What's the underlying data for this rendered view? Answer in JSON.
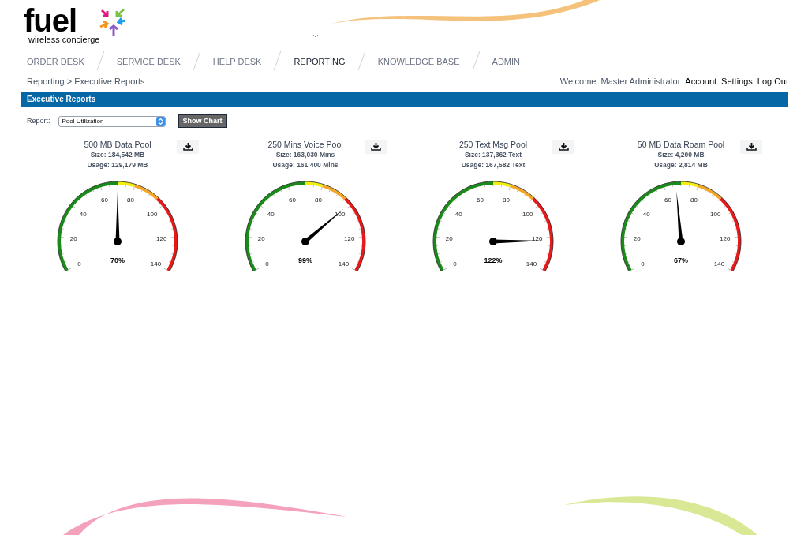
{
  "logo": {
    "wordmark": "fuel",
    "tagline": "wireless concierge"
  },
  "nav": [
    {
      "label": "ORDER DESK",
      "selected": false
    },
    {
      "label": "SERVICE DESK",
      "selected": false
    },
    {
      "label": "HELP DESK",
      "selected": false
    },
    {
      "label": "REPORTING",
      "selected": true
    },
    {
      "label": "KNOWLEDGE BASE",
      "selected": false
    },
    {
      "label": "ADMIN",
      "selected": false
    }
  ],
  "breadcrumb": "Reporting > Executive Reports",
  "user_bar": {
    "welcome": "Welcome",
    "user": "Master Administrator",
    "links": [
      "Account",
      "Settings",
      "Log Out"
    ]
  },
  "section_title": "Executive Reports",
  "report": {
    "label": "Report:",
    "value": "Pool Utilization",
    "button": "Show Chart"
  },
  "gauges": [
    {
      "title": "500 MB Data Pool",
      "size": "Size: 184,542 MB",
      "usage": "Usage: 129,179 MB",
      "reading": "70%",
      "level": 0.5,
      "ticks": [
        "0",
        "20",
        "40",
        "60",
        "80",
        "100",
        "120",
        "140"
      ]
    },
    {
      "title": "250 Mins Voice Pool",
      "size": "Size: 163,030 Mins",
      "usage": "Usage: 161,400 Mins",
      "reading": "99%",
      "level": 0.7071,
      "ticks": [
        "0",
        "20",
        "40",
        "60",
        "80",
        "100",
        "120",
        "140"
      ]
    },
    {
      "title": "250 Text Msg Pool",
      "size": "Size: 137,362 Text",
      "usage": "Usage: 167,582 Text",
      "reading": "122%",
      "level": 0.8714,
      "ticks": [
        "0",
        "20",
        "40",
        "60",
        "80",
        "100",
        "120",
        "140"
      ]
    },
    {
      "title": "50 MB Data Roam Pool",
      "size": "Size: 4,200 MB",
      "usage": "Usage: 2,814 MB",
      "reading": "67%",
      "level": 0.4786,
      "ticks": [
        "0",
        "20",
        "40",
        "60",
        "80",
        "100",
        "120",
        "140"
      ]
    }
  ]
}
